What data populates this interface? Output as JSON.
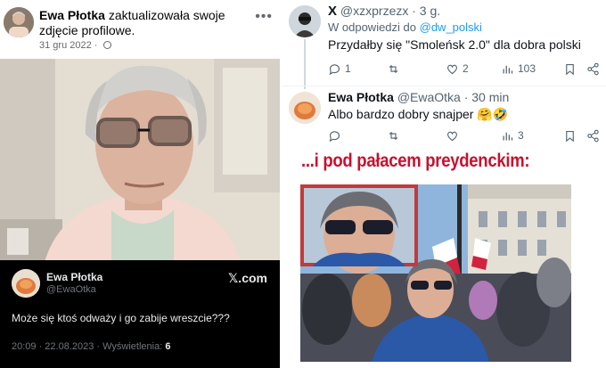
{
  "facebook": {
    "author": "Ewa Płotka",
    "action": "zaktualizowała swoje zdjęcie profilowe.",
    "date": "31 gru 2022",
    "date_separator": "·",
    "more_icon": "more-dots-icon",
    "embedded_tweet": {
      "name": "Ewa Płotka",
      "handle": "@EwaOtka",
      "logo": "𝕏.com",
      "text": "Może się ktoś odważy i go zabije wreszcie???",
      "meta_prefix": "20:09 · 22.08.2023 · Wyświetlenia: ",
      "views": "6"
    }
  },
  "thread": {
    "tweet1": {
      "name": "X",
      "handle_time": "@xzxprzezx · 3 g.",
      "reply_prefix": "W odpowiedzi do ",
      "reply_to": "@dw_polski",
      "text": "Przydałby się \"Smoleńsk 2.0\" dla dobra polski",
      "replies": "1",
      "retweets": "",
      "likes": "2",
      "views": "103"
    },
    "tweet2": {
      "name": "Ewa Płotka",
      "handle_time": "@EwaOtka · 30 min",
      "text": "Albo bardzo dobry snajper 🤗🤣",
      "replies": "",
      "retweets": "",
      "likes": "",
      "views": "3"
    }
  },
  "caption": {
    "headline": "...i pod pałacem preydenckim:"
  },
  "colors": {
    "headline": "#c8102e",
    "link": "#1d9bf0",
    "dark_bg": "#000000"
  }
}
